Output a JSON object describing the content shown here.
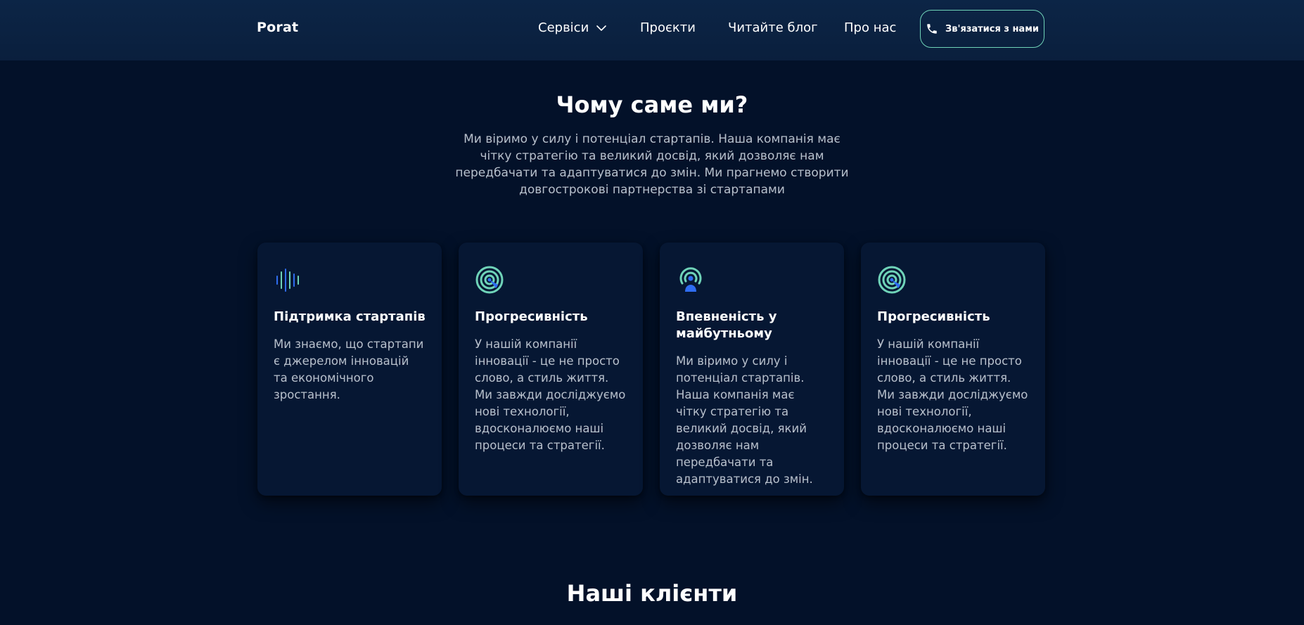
{
  "header": {
    "logo": "Porat",
    "nav": {
      "services": "Сервіси",
      "projects": "Проєкти",
      "blog": "Читайте блог",
      "about": "Про нас"
    },
    "contact_button": "Зв'язатися з нами",
    "accent_color": "#6fd3b8"
  },
  "why_us": {
    "title": "Чому саме ми?",
    "description": "Ми віримо у силу і потенціал стартапів. Наша компанія має чітку стратегію та великий досвід, який дозволяє нам передбачати та адаптуватися до змін. Ми прагнемо створити довгострокові партнерства зі стартапами",
    "cards": [
      {
        "icon": "sound-wave-icon",
        "title": "Підтримка стартапів",
        "text": "Ми знаємо, що стартапи є джерелом інновацій та економічного зростання."
      },
      {
        "icon": "target-icon",
        "title": "Прогресивність",
        "text": "У нашій компанії інновації - це не просто слово, а стиль життя. Ми завжди досліджуємо нові технології, вдосконалюємо наші процеси та стратегії."
      },
      {
        "icon": "broadcast-user-icon",
        "title": "Впевненість у майбутньому",
        "text": "Ми віримо у силу і потенціал стартапів. Наша компанія має чітку стратегію та великий досвід, який дозволяє нам передбачати та адаптуватися до змін."
      },
      {
        "icon": "target-icon",
        "title": "Прогресивність",
        "text": "У нашій компанії інновації - це не просто слово, а стиль життя. Ми завжди досліджуємо нові технології, вдосконалюємо наші процеси та стратегії."
      }
    ]
  },
  "clients": {
    "title": "Наші клієнти"
  }
}
